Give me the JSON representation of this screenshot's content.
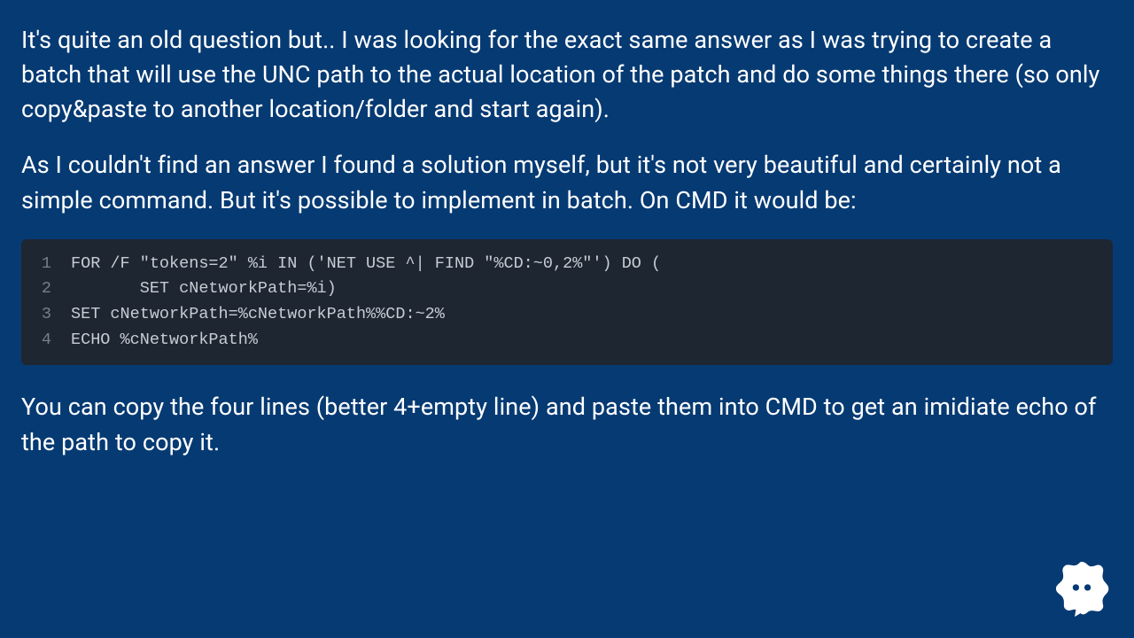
{
  "paragraphs": {
    "p1": "It's quite an old question but.. I was looking for the exact same answer as I was trying to create a batch that will use the UNC path to the actual location of the patch and do some things there (so only copy&paste to another location/folder and start again).",
    "p2": "As I couldn't find an answer I found a solution myself, but it's not very beautiful and certainly not a simple command. But it's possible to implement in batch. On CMD it would be:",
    "p3": "You can copy the four lines (better 4+empty line) and paste them into CMD to get an imidiate echo of the path to copy it."
  },
  "code": {
    "lines": [
      {
        "n": "1",
        "t": "FOR /F \"tokens=2\" %i IN ('NET USE ^| FIND \"%CD:~0,2%\"') DO ("
      },
      {
        "n": "2",
        "t": "       SET cNetworkPath=%i)"
      },
      {
        "n": "3",
        "t": "SET cNetworkPath=%cNetworkPath%%CD:~2%"
      },
      {
        "n": "4",
        "t": "ECHO %cNetworkPath%"
      }
    ]
  },
  "icon": {
    "name": "chat-bubble-icon"
  }
}
